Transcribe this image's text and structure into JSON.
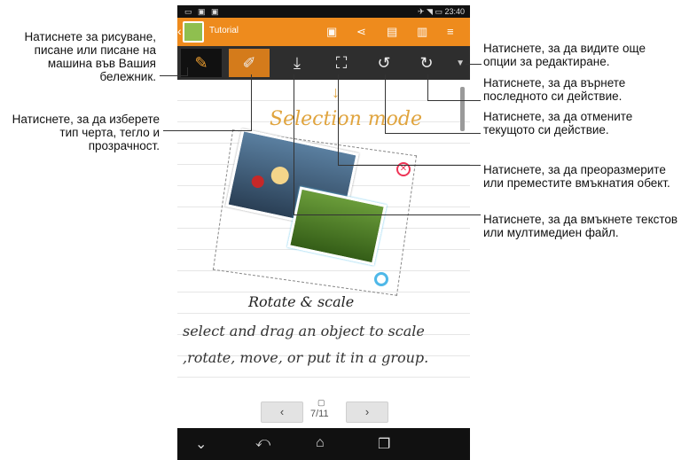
{
  "callouts": {
    "draw": "Натиснете за рисуване, писане или писане на машина във Вашия бележник.",
    "stroke": "Натиснете, за да изберете тип черта, тегло и прозрачност.",
    "more": "Натиснете, за да видите още опции за редактиране.",
    "redo": "Натиснете, за да върнете последното си действие.",
    "undo": "Натиснете, за да отмените текущото си действие.",
    "resize": "Натиснете, за да преоразмерите или преместите вмъкнатия обект.",
    "insert": "Натиснете, за да вмъкнете текстов или мултимедиен файл."
  },
  "device": {
    "status_time": "23:40",
    "status_icons_left": "▭ ▣ ▣",
    "status_icons_right": "✈ ◥ ▭",
    "app_title": "Tutorial",
    "actionbar_icons": [
      "save-icon",
      "share-icon",
      "add-page-icon",
      "page-options-icon",
      "menu-icon"
    ],
    "toolbar_icons": [
      "draw-mode-icon",
      "pen-icon",
      "insert-icon",
      "selection-icon",
      "undo-icon",
      "redo-icon",
      "more-arrow-icon"
    ],
    "selection_mode": "Selection mode",
    "rotate_scale": "Rotate & scale",
    "hand1": "select and drag an object to scale",
    "hand2": ",rotate, move, or put it in a group.",
    "page_counter": "7/11"
  },
  "colors": {
    "accent": "#ee8b1d",
    "toolbar": "#2e2e2e",
    "selection": "#4fb8e8",
    "handwriting_accent": "#e0a43e"
  }
}
